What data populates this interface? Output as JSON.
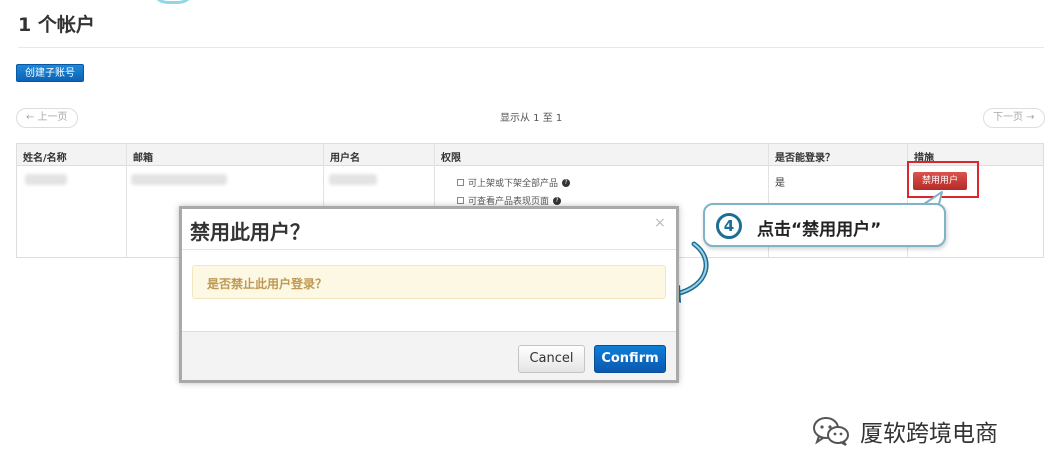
{
  "page": {
    "title": "1 个帐户",
    "create_button": "创建子账号",
    "prev": "← 上一页",
    "next": "下一页 →",
    "showing": "显示从 1 至 1"
  },
  "table": {
    "headers": [
      "姓名/名称",
      "邮箱",
      "用户名",
      "权限",
      "是否能登录？",
      "措施"
    ],
    "row": {
      "permissions": [
        "可上架或下架全部产品",
        "可查看产品表现页面"
      ],
      "can_login": "是",
      "action": "禁用用户"
    }
  },
  "modal": {
    "title": "禁用此用户？",
    "close": "×",
    "message": "是否禁止此用户登录？",
    "cancel": "Cancel",
    "confirm": "Confirm"
  },
  "callout": {
    "step": "4",
    "text": "点击“禁用用户”"
  },
  "watermark": {
    "text": "厦软跨境电商",
    "icon": "wechat-logo-icon"
  },
  "colors": {
    "primary": "#0c63b6",
    "danger": "#c9302c",
    "alert_bg": "#fcf8e3",
    "alert_text": "#c09853",
    "callout_accent": "#1b6f95"
  }
}
